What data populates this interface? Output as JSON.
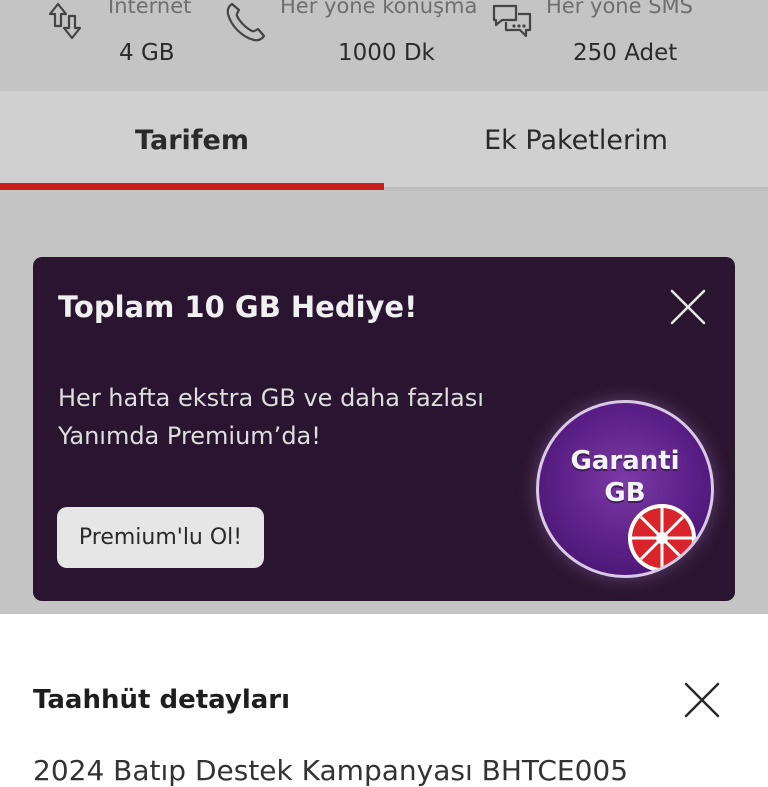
{
  "allowances": [
    {
      "label": "İnternet",
      "value": "4 GB",
      "icon": "data-transfer-icon"
    },
    {
      "label": "Her yöne konuşma",
      "value": "1000 Dk",
      "icon": "phone-icon"
    },
    {
      "label": "Her yöne SMS",
      "value": "250 Adet",
      "icon": "chat-bubbles-icon"
    }
  ],
  "tabs": [
    {
      "label": "Tarifem",
      "active": true
    },
    {
      "label": "Ek Paketlerim",
      "active": false
    }
  ],
  "promo": {
    "title": "Toplam 10 GB Hediye!",
    "description_line1": "Her hafta ekstra GB ve daha fazlası",
    "description_line2": "Yanımda Premium’da!",
    "button_label": "Premium'lu Ol!",
    "badge_line1": "Garanti",
    "badge_line2": "GB"
  },
  "sheet": {
    "title": "Taahhüt detayları",
    "body_partial": "2024 Batıp Destek Kampanyası BHTCE005"
  },
  "colors": {
    "accent_red": "#c8201a",
    "promo_bg": "#2a1530",
    "badge_purple": "#5a1f86"
  }
}
